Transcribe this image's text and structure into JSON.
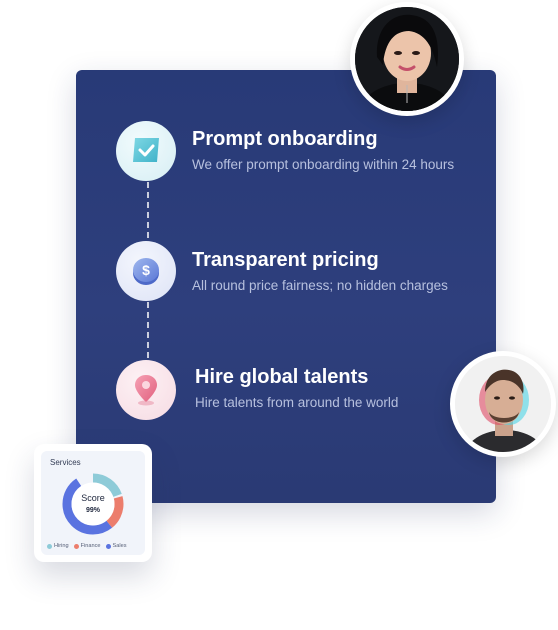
{
  "steps": [
    {
      "title": "Prompt onboarding",
      "description": "We offer prompt onboarding within 24 hours",
      "icon": "checkbox-icon"
    },
    {
      "title": "Transparent pricing",
      "description": "All round price fairness; no hidden charges",
      "icon": "dollar-coin-icon"
    },
    {
      "title": "Hire global talents",
      "description": "Hire talents from around the world",
      "icon": "location-pin-icon"
    }
  ],
  "services_card": {
    "title": "Services",
    "center_label": "Score",
    "center_value": "99%",
    "legend": [
      {
        "label": "Hiring",
        "color": "#8ecbd8"
      },
      {
        "label": "Finance",
        "color": "#ec7d6c"
      },
      {
        "label": "Sales",
        "color": "#5a73e0"
      }
    ]
  },
  "colors": {
    "panel": "#2b3c78",
    "step_desc": "#b7c0de"
  }
}
